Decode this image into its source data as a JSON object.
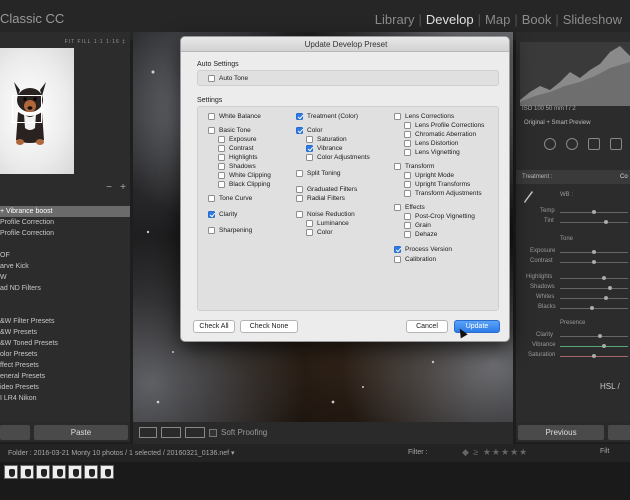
{
  "app": {
    "title": "Classic CC"
  },
  "modules": [
    {
      "label": "Library",
      "active": false
    },
    {
      "label": "Develop",
      "active": true
    },
    {
      "label": "Map",
      "active": false
    },
    {
      "label": "Book",
      "active": false
    },
    {
      "label": "Slideshow",
      "active": false
    }
  ],
  "navigator": {
    "zoom_options": "FIT  FILL  1:1  1:16 ‡"
  },
  "presets": {
    "items": [
      {
        "label": "+ Vibrance boost",
        "selected": true
      },
      {
        "label": "Profile Correction",
        "selected": false
      },
      {
        "label": "Profile Correction",
        "selected": false
      },
      {
        "label": "",
        "selected": false
      },
      {
        "label": "OF",
        "selected": false
      },
      {
        "label": "arve Kick",
        "selected": false
      },
      {
        "label": "W",
        "selected": false
      },
      {
        "label": "ad ND Filters",
        "selected": false
      },
      {
        "label": "",
        "selected": false
      },
      {
        "label": "",
        "selected": false
      },
      {
        "label": "&W Filter Presets",
        "selected": false
      },
      {
        "label": "&W Presets",
        "selected": false
      },
      {
        "label": "&W Toned Presets",
        "selected": false
      },
      {
        "label": "olor Presets",
        "selected": false
      },
      {
        "label": "ffect Presets",
        "selected": false
      },
      {
        "label": "eneral Presets",
        "selected": false
      },
      {
        "label": "ideo Presets",
        "selected": false
      },
      {
        "label": "I LR4 Nikon",
        "selected": false
      }
    ]
  },
  "left_buttons": {
    "paste": "Paste"
  },
  "toolbar": {
    "soft_proofing": "Soft Proofing"
  },
  "right_panel": {
    "histogram_info": "ISO 100        50 mm      f / 2",
    "preview": "Original + Smart Preview",
    "section": "Treatment :",
    "section_value": "Co",
    "wb": "WB :",
    "temp": "Temp",
    "tint": "Tint",
    "tone": "Tone",
    "exposure": "Exposure",
    "contrast": "Contrast",
    "highlights": "Highlights",
    "shadows": "Shadows",
    "whites": "Whites",
    "blacks": "Blacks",
    "presence": "Presence",
    "clarity": "Clarity",
    "vibrance": "Vibrance",
    "saturation": "Saturation",
    "hsl": "HSL  /",
    "previous": "Previous"
  },
  "filmbar": {
    "info": "Folder : 2016-03-21 Monty      10 photos / 1 selected / 20160321_0136.nef ▾",
    "filter": "Filter :",
    "custom": "Filt"
  },
  "dialog": {
    "title": "Update Develop Preset",
    "auto_settings_label": "Auto Settings",
    "auto_tone": {
      "label": "Auto Tone",
      "checked": false
    },
    "settings_label": "Settings",
    "col1": [
      {
        "label": "White Balance",
        "checked": false,
        "indent": 0
      },
      {
        "label": "Basic Tone",
        "checked": false,
        "indent": 0
      },
      {
        "label": "Exposure",
        "checked": false,
        "indent": 1
      },
      {
        "label": "Contrast",
        "checked": false,
        "indent": 1
      },
      {
        "label": "Highlights",
        "checked": false,
        "indent": 1
      },
      {
        "label": "Shadows",
        "checked": false,
        "indent": 1
      },
      {
        "label": "White Clipping",
        "checked": false,
        "indent": 1
      },
      {
        "label": "Black Clipping",
        "checked": false,
        "indent": 1
      },
      {
        "label": "Tone Curve",
        "checked": false,
        "indent": 0
      },
      {
        "label": "Clarity",
        "checked": true,
        "indent": 0
      },
      {
        "label": "Sharpening",
        "checked": false,
        "indent": 0
      }
    ],
    "col2": [
      {
        "label": "Treatment (Color)",
        "checked": true,
        "indent": 0
      },
      {
        "label": "Color",
        "checked": true,
        "indent": 0
      },
      {
        "label": "Saturation",
        "checked": false,
        "indent": 1
      },
      {
        "label": "Vibrance",
        "checked": true,
        "indent": 1
      },
      {
        "label": "Color Adjustments",
        "checked": false,
        "indent": 1
      },
      {
        "label": "Split Toning",
        "checked": false,
        "indent": 0
      },
      {
        "label": "Graduated Filters",
        "checked": false,
        "indent": 0
      },
      {
        "label": "Radial Filters",
        "checked": false,
        "indent": 0
      },
      {
        "label": "Noise Reduction",
        "checked": false,
        "indent": 0
      },
      {
        "label": "Luminance",
        "checked": false,
        "indent": 1
      },
      {
        "label": "Color",
        "checked": false,
        "indent": 1
      }
    ],
    "col3": [
      {
        "label": "Lens Corrections",
        "checked": false,
        "indent": 0
      },
      {
        "label": "Lens Profile Corrections",
        "checked": false,
        "indent": 1
      },
      {
        "label": "Chromatic Aberration",
        "checked": false,
        "indent": 1
      },
      {
        "label": "Lens Distortion",
        "checked": false,
        "indent": 1
      },
      {
        "label": "Lens Vignetting",
        "checked": false,
        "indent": 1
      },
      {
        "label": "Transform",
        "checked": false,
        "indent": 0
      },
      {
        "label": "Upright Mode",
        "checked": false,
        "indent": 1
      },
      {
        "label": "Upright Transforms",
        "checked": false,
        "indent": 1
      },
      {
        "label": "Transform Adjustments",
        "checked": false,
        "indent": 1
      },
      {
        "label": "Effects",
        "checked": false,
        "indent": 0
      },
      {
        "label": "Post-Crop Vignetting",
        "checked": false,
        "indent": 1
      },
      {
        "label": "Grain",
        "checked": false,
        "indent": 1
      },
      {
        "label": "Dehaze",
        "checked": false,
        "indent": 1
      },
      {
        "label": "Process Version",
        "checked": true,
        "indent": 0
      },
      {
        "label": "Calibration",
        "checked": false,
        "indent": 0
      }
    ],
    "buttons": {
      "check_all": "Check All",
      "check_none": "Check None",
      "cancel": "Cancel",
      "update": "Update"
    }
  }
}
